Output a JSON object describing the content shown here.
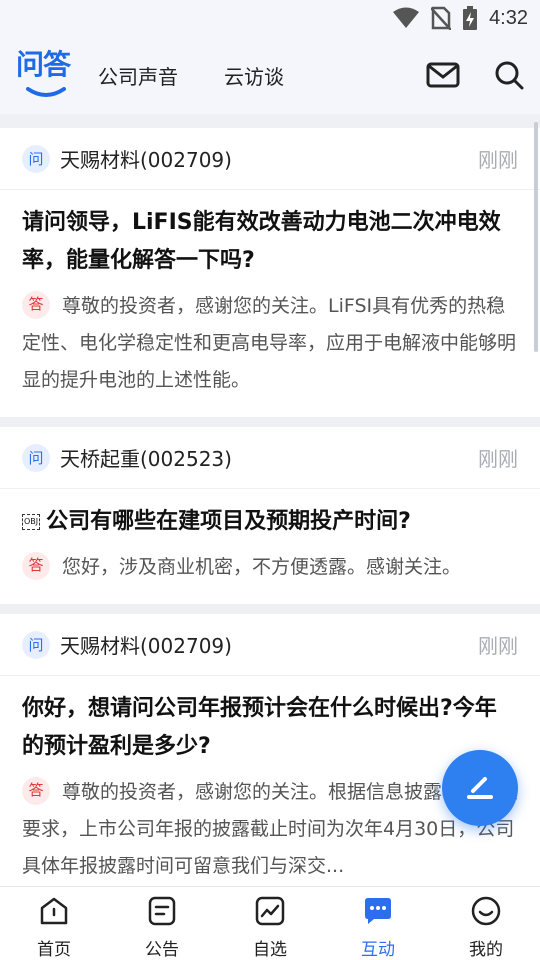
{
  "status_bar": {
    "time": "4:32"
  },
  "header": {
    "logo_text": "问答",
    "tabs": [
      {
        "label": "公司声音"
      },
      {
        "label": "云访谈"
      }
    ]
  },
  "feed": [
    {
      "q_badge": "问",
      "company": "天赐材料(002709)",
      "time": "刚刚",
      "question": "请问领导，LiFIS能有效改善动力电池二次冲电效率，能量化解答一下吗?",
      "a_badge": "答",
      "answer": "尊敬的投资者，感谢您的关注。LiFSI具有优秀的热稳定性、电化学稳定性和更高电导率，应用于电解液中能够明显的提升电池的上述性能。"
    },
    {
      "q_badge": "问",
      "company": "天桥起重(002523)",
      "time": "刚刚",
      "question_prefix": "OBJ",
      "question": "公司有哪些在建项目及预期投产时间?",
      "a_badge": "答",
      "answer": "您好，涉及商业机密，不方便透露。感谢关注。"
    },
    {
      "q_badge": "问",
      "company": "天赐材料(002709)",
      "time": "刚刚",
      "question": "你好，想请问公司年报预计会在什么时候出?今年的预计盈利是多少?",
      "a_badge": "答",
      "answer": "尊敬的投资者，感谢您的关注。根据信息披露相关规定要求，上市公司年报的披露截止时间为次年4月30日，公司具体年报披露时间可留意我们与深交..."
    }
  ],
  "bottom_nav": [
    {
      "label": "首页",
      "icon": "home-icon"
    },
    {
      "label": "公告",
      "icon": "notice-icon"
    },
    {
      "label": "自选",
      "icon": "watchlist-icon"
    },
    {
      "label": "互动",
      "icon": "interact-icon",
      "active": true
    },
    {
      "label": "我的",
      "icon": "profile-icon"
    }
  ],
  "colors": {
    "accent": "#2d6ef0",
    "answer_badge": "#e2373a",
    "fab": "#2e7ff0"
  }
}
